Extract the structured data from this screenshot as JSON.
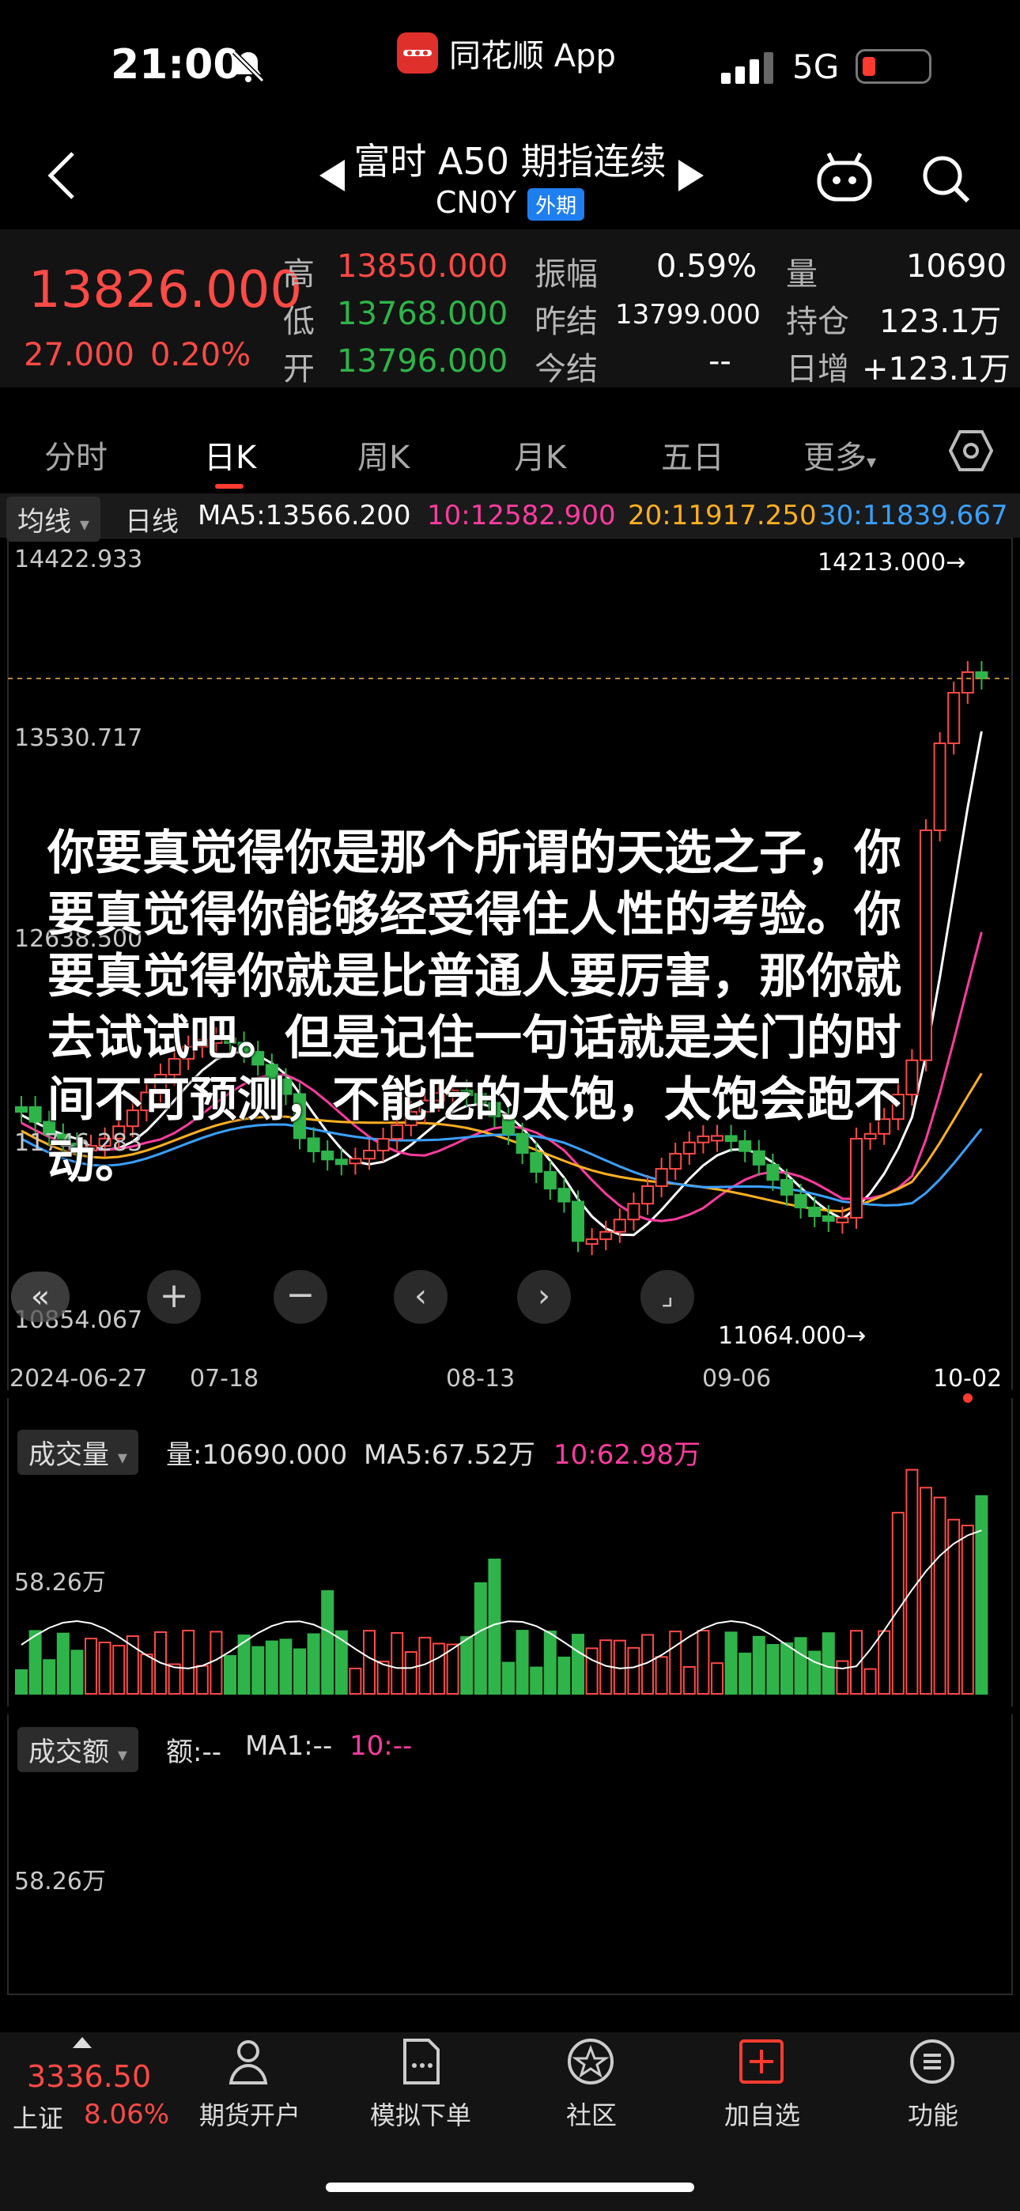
{
  "status_bar": {
    "time": "21:00",
    "network": "5G"
  },
  "app_badge": {
    "name": "同花顺 App"
  },
  "header": {
    "title": "富时 A50 期指连续",
    "code": "CN0Y",
    "tag": "外期"
  },
  "quote": {
    "last_price": "13826.000",
    "change": "27.000",
    "change_pct": "0.20%",
    "high_label": "高",
    "high": "13850.000",
    "low_label": "低",
    "low": "13768.000",
    "open_label": "开",
    "open": "13796.000",
    "amp_label": "振幅",
    "amp": "0.59%",
    "prev_settle_label": "昨结",
    "prev_settle": "13799.000",
    "settle_label": "今结",
    "settle": "--",
    "vol_label": "量",
    "vol": "10690",
    "oi_label": "持仓",
    "oi": "123.1万",
    "oi_chg_label": "日增",
    "oi_chg": "+123.1万"
  },
  "tabs": [
    "分时",
    "日K",
    "周K",
    "月K",
    "五日",
    "更多"
  ],
  "ma_row": {
    "pill": "均线",
    "period": "日线",
    "ma5": "MA5:13566.200",
    "ma10": "10:12582.900",
    "ma20": "20:11917.250",
    "ma30": "30:11839.667"
  },
  "colors": {
    "up": "#ff4a46",
    "down": "#2fb44a",
    "ma5": "#ffffff",
    "ma10": "#ff3ca0",
    "ma20": "#ffb020",
    "ma30": "#3aa0ff"
  },
  "kline": {
    "y_labels": [
      "14422.933",
      "13530.717",
      "12638.500",
      "11746.283",
      "10854.067"
    ],
    "high_marker": "14213.000→",
    "low_marker": "11064.000→",
    "x_labels": [
      "2024-06-27",
      "07-18",
      "08-13",
      "09-06",
      "10-02"
    ]
  },
  "overlay_caption": "你要真觉得你是那个所谓的天选之子，你要真觉得你能够经受得住人性的考验。你要真觉得你就是比普通人要厉害，那你就去试试吧。但是记住一句话就是关门的时间不可预测，不能吃的太饱，太饱会跑不动。",
  "volume_panel": {
    "pill": "成交量",
    "vol": "量:10690.000",
    "ma5": "MA5:67.52万",
    "ma10": "10:62.98万",
    "y_label": "58.26万"
  },
  "amount_panel": {
    "pill": "成交额",
    "amt": "额:--",
    "ma1": "MA1:--",
    "ma10": "10:--",
    "y_label": "58.26万"
  },
  "index_quote": {
    "value": "3336.50",
    "name": "上证",
    "pct": "8.06%"
  },
  "bottom_tabs": [
    "期货开户",
    "模拟下单",
    "社区",
    "加自选",
    "功能"
  ]
}
